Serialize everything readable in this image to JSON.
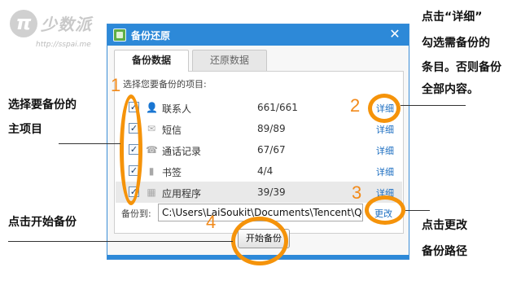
{
  "brand": {
    "logo_text": "少数派",
    "url": "http://sspai.me"
  },
  "window": {
    "title": "备份还原",
    "close_glyph": "✕",
    "tabs": [
      {
        "label": "备份数据",
        "active": true
      },
      {
        "label": "还原数据",
        "active": false
      }
    ],
    "prompt": "选择您要备份的项目:",
    "items": [
      {
        "name": "联系人",
        "count": "661/661",
        "checked": true,
        "icon": "contact-icon",
        "detail": "详细"
      },
      {
        "name": "短信",
        "count": "89/89",
        "checked": true,
        "icon": "sms-icon",
        "detail": "详细"
      },
      {
        "name": "通话记录",
        "count": "67/67",
        "checked": true,
        "icon": "call-log-icon",
        "detail": "详细"
      },
      {
        "name": "书签",
        "count": "4/4",
        "checked": true,
        "icon": "bookmark-icon",
        "detail": "详细"
      },
      {
        "name": "应用程序",
        "count": "39/39",
        "checked": true,
        "icon": "apps-icon",
        "detail": "详细"
      }
    ],
    "path_label": "备份到:",
    "path_value": "C:\\Users\\LaiSoukit\\Documents\\Tencent\\Q",
    "change_label": "更改",
    "start_button": "开始备份"
  },
  "annotations": {
    "numbers": [
      "1",
      "2",
      "3",
      "4"
    ],
    "top_right": [
      "点击“详细”",
      "勾选需备份的",
      "条目。否则备份",
      "全部内容。"
    ],
    "left": [
      "选择要备份的",
      "主项目"
    ],
    "start": "点击开始备份",
    "change": [
      "点击更改",
      "备份路径"
    ],
    "accent_color": "#f5930a"
  }
}
